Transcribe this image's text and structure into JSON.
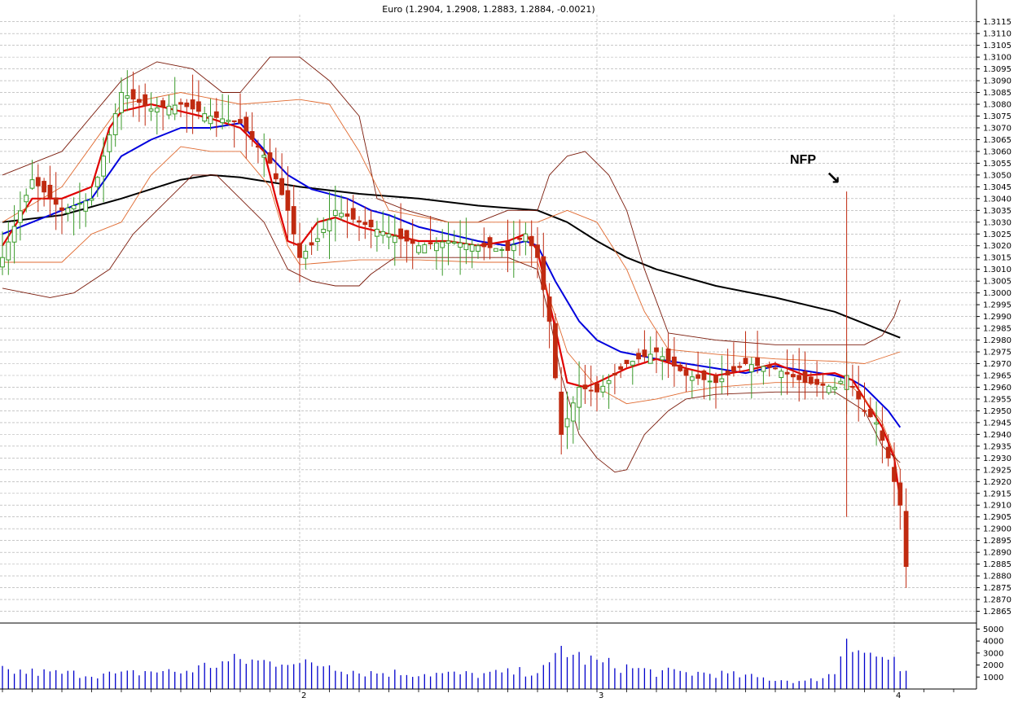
{
  "chart_data": {
    "type": "candlestick",
    "title": "Euro (1.2904, 1.2908, 1.2883, 1.2884, -0.0021)",
    "ylim": [
      1.286,
      1.3118
    ],
    "y_ticks": [
      "1.3115",
      "1.3110",
      "1.3105",
      "1.3100",
      "1.3095",
      "1.3090",
      "1.3085",
      "1.3080",
      "1.3075",
      "1.3070",
      "1.3065",
      "1.3060",
      "1.3055",
      "1.3050",
      "1.3045",
      "1.3040",
      "1.3035",
      "1.3030",
      "1.3025",
      "1.3020",
      "1.3015",
      "1.3010",
      "1.3005",
      "1.3000",
      "1.2995",
      "1.2990",
      "1.2985",
      "1.2980",
      "1.2975",
      "1.2970",
      "1.2965",
      "1.2960",
      "1.2955",
      "1.2950",
      "1.2945",
      "1.2940",
      "1.2935",
      "1.2930",
      "1.2925",
      "1.2920",
      "1.2915",
      "1.2910",
      "1.2905",
      "1.2900",
      "1.2895",
      "1.2890",
      "1.2885",
      "1.2880",
      "1.2875",
      "1.2870",
      "1.2865"
    ],
    "x_ticks": [
      {
        "label": "2",
        "bar": 50
      },
      {
        "label": "3",
        "bar": 100
      },
      {
        "label": "4",
        "bar": 150
      }
    ],
    "bar_count": 181,
    "grid": true,
    "price_anchors": [
      [
        0,
        1.3015
      ],
      [
        5,
        1.3048
      ],
      [
        10,
        1.3035
      ],
      [
        15,
        1.304
      ],
      [
        20,
        1.3085
      ],
      [
        25,
        1.3078
      ],
      [
        30,
        1.308
      ],
      [
        35,
        1.3075
      ],
      [
        40,
        1.3072
      ],
      [
        45,
        1.3055
      ],
      [
        48,
        1.3035
      ],
      [
        50,
        1.3015
      ],
      [
        53,
        1.3023
      ],
      [
        56,
        1.3035
      ],
      [
        60,
        1.303
      ],
      [
        65,
        1.3025
      ],
      [
        70,
        1.302
      ],
      [
        75,
        1.3022
      ],
      [
        80,
        1.302
      ],
      [
        85,
        1.3018
      ],
      [
        88,
        1.3025
      ],
      [
        90,
        1.3015
      ],
      [
        92,
        1.2988
      ],
      [
        94,
        1.294
      ],
      [
        97,
        1.296
      ],
      [
        100,
        1.2958
      ],
      [
        105,
        1.297
      ],
      [
        110,
        1.2975
      ],
      [
        115,
        1.2965
      ],
      [
        120,
        1.2962
      ],
      [
        125,
        1.297
      ],
      [
        130,
        1.2968
      ],
      [
        135,
        1.2962
      ],
      [
        140,
        1.296
      ],
      [
        142,
        1.2965
      ],
      [
        145,
        1.295
      ],
      [
        147,
        1.2945
      ],
      [
        149,
        1.293
      ],
      [
        151,
        1.291
      ],
      [
        152,
        1.2884
      ]
    ],
    "nfp_bar": 142,
    "nfp_range": [
      1.2905,
      1.3043
    ],
    "series": [
      {
        "name": "",
        "style": "ma_black",
        "points": [
          [
            0,
            1.303
          ],
          [
            10,
            1.3033
          ],
          [
            20,
            1.304
          ],
          [
            30,
            1.3048
          ],
          [
            35,
            1.305
          ],
          [
            40,
            1.3049
          ],
          [
            50,
            1.3045
          ],
          [
            60,
            1.3042
          ],
          [
            70,
            1.304
          ],
          [
            80,
            1.3037
          ],
          [
            90,
            1.3035
          ],
          [
            95,
            1.303
          ],
          [
            100,
            1.3022
          ],
          [
            105,
            1.3015
          ],
          [
            110,
            1.301
          ],
          [
            120,
            1.3003
          ],
          [
            130,
            1.2998
          ],
          [
            140,
            1.2992
          ],
          [
            145,
            1.2987
          ],
          [
            151,
            1.2981
          ]
        ]
      },
      {
        "name": "",
        "style": "ma_blue",
        "points": [
          [
            0,
            1.3025
          ],
          [
            5,
            1.303
          ],
          [
            10,
            1.3035
          ],
          [
            15,
            1.304
          ],
          [
            20,
            1.3058
          ],
          [
            25,
            1.3065
          ],
          [
            30,
            1.307
          ],
          [
            35,
            1.307
          ],
          [
            40,
            1.3072
          ],
          [
            45,
            1.3058
          ],
          [
            48,
            1.305
          ],
          [
            52,
            1.3044
          ],
          [
            58,
            1.304
          ],
          [
            62,
            1.3035
          ],
          [
            65,
            1.3033
          ],
          [
            70,
            1.3028
          ],
          [
            75,
            1.3025
          ],
          [
            80,
            1.3022
          ],
          [
            85,
            1.302
          ],
          [
            88,
            1.3022
          ],
          [
            90,
            1.302
          ],
          [
            93,
            1.3005
          ],
          [
            97,
            1.2988
          ],
          [
            100,
            1.298
          ],
          [
            104,
            1.2975
          ],
          [
            110,
            1.2972
          ],
          [
            120,
            1.2968
          ],
          [
            125,
            1.2966
          ],
          [
            130,
            1.2969
          ],
          [
            135,
            1.2967
          ],
          [
            140,
            1.2965
          ],
          [
            143,
            1.2963
          ],
          [
            145,
            1.296
          ],
          [
            149,
            1.295
          ],
          [
            151,
            1.2943
          ]
        ]
      },
      {
        "name": "",
        "style": "ma_red",
        "points": [
          [
            0,
            1.302
          ],
          [
            5,
            1.304
          ],
          [
            10,
            1.304
          ],
          [
            15,
            1.3045
          ],
          [
            18,
            1.307
          ],
          [
            20,
            1.3077
          ],
          [
            25,
            1.308
          ],
          [
            30,
            1.3077
          ],
          [
            35,
            1.3074
          ],
          [
            40,
            1.307
          ],
          [
            44,
            1.306
          ],
          [
            46,
            1.304
          ],
          [
            48,
            1.3022
          ],
          [
            50,
            1.302
          ],
          [
            53,
            1.303
          ],
          [
            56,
            1.3032
          ],
          [
            60,
            1.3028
          ],
          [
            65,
            1.3025
          ],
          [
            70,
            1.3022
          ],
          [
            75,
            1.3022
          ],
          [
            80,
            1.302
          ],
          [
            85,
            1.3022
          ],
          [
            88,
            1.3025
          ],
          [
            90,
            1.3018
          ],
          [
            93,
            1.2985
          ],
          [
            95,
            1.2962
          ],
          [
            98,
            1.296
          ],
          [
            100,
            1.2962
          ],
          [
            105,
            1.2968
          ],
          [
            110,
            1.2972
          ],
          [
            115,
            1.2968
          ],
          [
            120,
            1.2965
          ],
          [
            125,
            1.2967
          ],
          [
            130,
            1.297
          ],
          [
            135,
            1.2965
          ],
          [
            140,
            1.2966
          ],
          [
            143,
            1.2963
          ],
          [
            145,
            1.2955
          ],
          [
            148,
            1.2943
          ],
          [
            150,
            1.293
          ],
          [
            151,
            1.2912
          ]
        ]
      },
      {
        "name": "",
        "style": "bb_upper",
        "points": [
          [
            0,
            1.305
          ],
          [
            10,
            1.306
          ],
          [
            20,
            1.309
          ],
          [
            26,
            1.3098
          ],
          [
            32,
            1.3095
          ],
          [
            37,
            1.3085
          ],
          [
            40,
            1.3085
          ],
          [
            45,
            1.31
          ],
          [
            50,
            1.31
          ],
          [
            55,
            1.309
          ],
          [
            60,
            1.3075
          ],
          [
            63,
            1.304
          ],
          [
            68,
            1.3035
          ],
          [
            75,
            1.303
          ],
          [
            80,
            1.303
          ],
          [
            85,
            1.3035
          ],
          [
            90,
            1.3035
          ],
          [
            92,
            1.305
          ],
          [
            95,
            1.3058
          ],
          [
            98,
            1.306
          ],
          [
            102,
            1.305
          ],
          [
            105,
            1.3035
          ],
          [
            108,
            1.301
          ],
          [
            112,
            1.2983
          ],
          [
            120,
            1.298
          ],
          [
            130,
            1.2978
          ],
          [
            140,
            1.2978
          ],
          [
            145,
            1.2978
          ],
          [
            148,
            1.2982
          ],
          [
            150,
            1.299
          ],
          [
            151,
            1.2997
          ]
        ]
      },
      {
        "name": "",
        "style": "bb_inner_upper",
        "points": [
          [
            0,
            1.303
          ],
          [
            10,
            1.3045
          ],
          [
            20,
            1.308
          ],
          [
            30,
            1.3085
          ],
          [
            40,
            1.308
          ],
          [
            50,
            1.3082
          ],
          [
            55,
            1.308
          ],
          [
            60,
            1.306
          ],
          [
            65,
            1.3035
          ],
          [
            75,
            1.303
          ],
          [
            85,
            1.303
          ],
          [
            90,
            1.303
          ],
          [
            95,
            1.3035
          ],
          [
            100,
            1.303
          ],
          [
            105,
            1.301
          ],
          [
            108,
            1.2992
          ],
          [
            112,
            1.2976
          ],
          [
            120,
            1.2974
          ],
          [
            130,
            1.2972
          ],
          [
            140,
            1.2971
          ],
          [
            145,
            1.297
          ],
          [
            151,
            1.2975
          ]
        ]
      },
      {
        "name": "",
        "style": "bb_inner_lower",
        "points": [
          [
            0,
            1.3013
          ],
          [
            10,
            1.3013
          ],
          [
            15,
            1.3025
          ],
          [
            20,
            1.303
          ],
          [
            25,
            1.305
          ],
          [
            30,
            1.3062
          ],
          [
            35,
            1.306
          ],
          [
            40,
            1.306
          ],
          [
            45,
            1.3045
          ],
          [
            48,
            1.302
          ],
          [
            50,
            1.3012
          ],
          [
            55,
            1.3013
          ],
          [
            60,
            1.3014
          ],
          [
            70,
            1.3014
          ],
          [
            80,
            1.3013
          ],
          [
            90,
            1.3013
          ],
          [
            92,
            1.2998
          ],
          [
            95,
            1.2975
          ],
          [
            100,
            1.296
          ],
          [
            105,
            1.2953
          ],
          [
            110,
            1.2955
          ],
          [
            115,
            1.2958
          ],
          [
            120,
            1.296
          ],
          [
            125,
            1.2961
          ],
          [
            130,
            1.2962
          ],
          [
            135,
            1.2962
          ],
          [
            140,
            1.2962
          ],
          [
            143,
            1.296
          ],
          [
            145,
            1.2955
          ],
          [
            148,
            1.2945
          ],
          [
            151,
            1.2925
          ]
        ]
      },
      {
        "name": "",
        "style": "bb_lower",
        "points": [
          [
            0,
            1.3002
          ],
          [
            8,
            1.2998
          ],
          [
            12,
            1.3
          ],
          [
            18,
            1.301
          ],
          [
            22,
            1.3025
          ],
          [
            28,
            1.304
          ],
          [
            32,
            1.305
          ],
          [
            36,
            1.305
          ],
          [
            40,
            1.304
          ],
          [
            44,
            1.303
          ],
          [
            48,
            1.301
          ],
          [
            52,
            1.3005
          ],
          [
            56,
            1.3003
          ],
          [
            60,
            1.3003
          ],
          [
            62,
            1.3008
          ],
          [
            66,
            1.3015
          ],
          [
            75,
            1.3015
          ],
          [
            85,
            1.3015
          ],
          [
            90,
            1.301
          ],
          [
            92,
            1.299
          ],
          [
            94,
            1.2965
          ],
          [
            97,
            1.294
          ],
          [
            100,
            1.293
          ],
          [
            103,
            1.2924
          ],
          [
            105,
            1.2925
          ],
          [
            108,
            1.294
          ],
          [
            112,
            1.295
          ],
          [
            115,
            1.2955
          ],
          [
            120,
            1.2957
          ],
          [
            130,
            1.2958
          ],
          [
            140,
            1.2958
          ],
          [
            145,
            1.295
          ],
          [
            148,
            1.2935
          ],
          [
            151,
            1.2928
          ]
        ]
      }
    ],
    "volume": {
      "y_ticks": [
        5000,
        4000,
        3000,
        2000,
        1000
      ],
      "ylim": [
        0,
        5500
      ],
      "anchors": [
        [
          0,
          1500
        ],
        [
          10,
          1300
        ],
        [
          20,
          1200
        ],
        [
          25,
          1500
        ],
        [
          30,
          1400
        ],
        [
          35,
          2000
        ],
        [
          40,
          2400
        ],
        [
          45,
          2200
        ],
        [
          48,
          2600
        ],
        [
          50,
          2000
        ],
        [
          55,
          2100
        ],
        [
          60,
          1400
        ],
        [
          70,
          1300
        ],
        [
          80,
          1200
        ],
        [
          90,
          1500
        ],
        [
          92,
          1800
        ],
        [
          94,
          3500
        ],
        [
          96,
          2800
        ],
        [
          100,
          2200
        ],
        [
          110,
          1400
        ],
        [
          120,
          1300
        ],
        [
          130,
          800
        ],
        [
          135,
          600
        ],
        [
          140,
          1300
        ],
        [
          142,
          4800
        ],
        [
          144,
          3500
        ],
        [
          146,
          2800
        ],
        [
          148,
          2600
        ],
        [
          150,
          2500
        ],
        [
          151,
          1200
        ]
      ]
    },
    "annotation": {
      "text": "NFP",
      "arrow": "↘"
    }
  }
}
